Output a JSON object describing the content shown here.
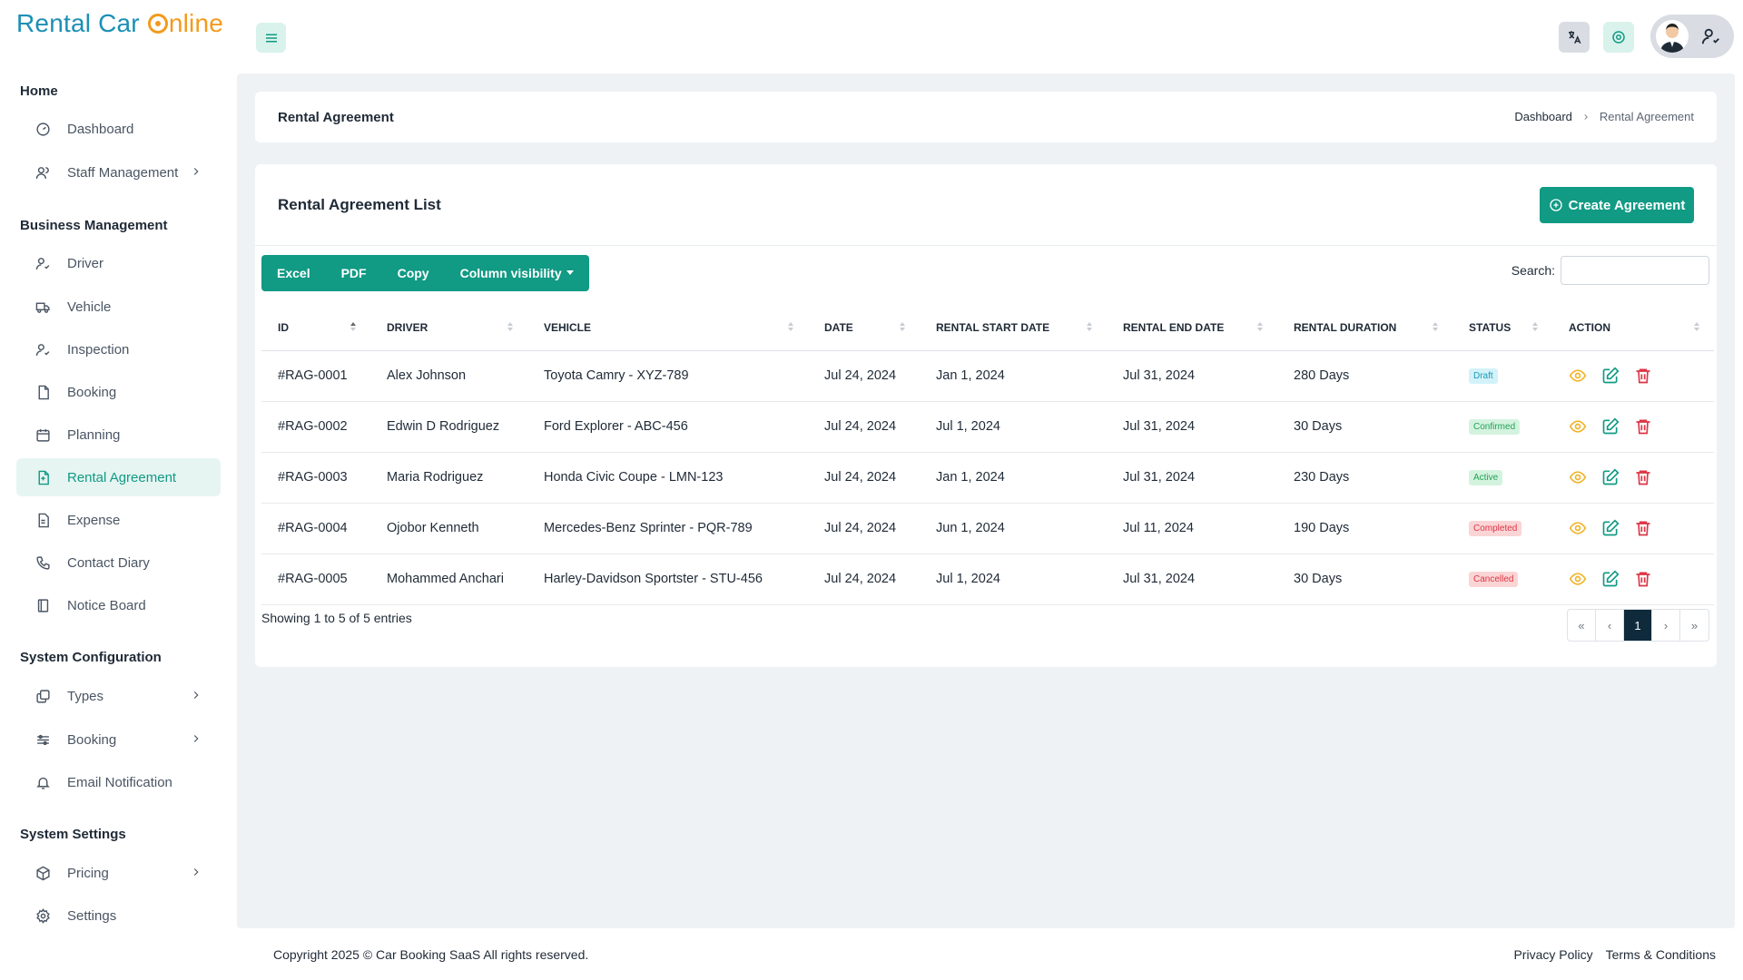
{
  "brand": {
    "part1": "Rental Car ",
    "part2": "nline"
  },
  "sidebar": {
    "sections": [
      {
        "title": "Home"
      },
      {
        "title": "Business Management"
      },
      {
        "title": "System Configuration"
      },
      {
        "title": "System Settings"
      }
    ],
    "items": [
      {
        "label": "Dashboard",
        "icon": "gauge-icon"
      },
      {
        "label": "Staff Management",
        "icon": "users-icon"
      },
      {
        "label": "Driver",
        "icon": "user-check-icon"
      },
      {
        "label": "Vehicle",
        "icon": "truck-icon"
      },
      {
        "label": "Inspection",
        "icon": "user-check-icon"
      },
      {
        "label": "Booking",
        "icon": "file-icon"
      },
      {
        "label": "Planning",
        "icon": "calendar-icon"
      },
      {
        "label": "Rental Agreement",
        "icon": "file-text-icon"
      },
      {
        "label": "Expense",
        "icon": "receipt-icon"
      },
      {
        "label": "Contact Diary",
        "icon": "phone-icon"
      },
      {
        "label": "Notice Board",
        "icon": "notebook-icon"
      },
      {
        "label": "Types",
        "icon": "layers-icon"
      },
      {
        "label": "Booking",
        "icon": "sliders-icon"
      },
      {
        "label": "Email Notification",
        "icon": "bell-icon"
      },
      {
        "label": "Pricing",
        "icon": "box-icon"
      },
      {
        "label": "Settings",
        "icon": "gear-icon"
      }
    ],
    "active": "Rental Agreement"
  },
  "page": {
    "title": "Rental Agreement",
    "breadcrumb": [
      "Dashboard",
      "Rental Agreement"
    ]
  },
  "list": {
    "title": "Rental Agreement List",
    "create_label": "Create Agreement",
    "export_buttons": [
      "Excel",
      "PDF",
      "Copy",
      "Column visibility"
    ],
    "search_label": "Search:",
    "search_value": "",
    "columns": [
      "ID",
      "DRIVER",
      "VEHICLE",
      "DATE",
      "RENTAL START DATE",
      "RENTAL END DATE",
      "RENTAL DURATION",
      "STATUS",
      "ACTION"
    ],
    "rows": [
      {
        "id": "#RAG-0001",
        "driver": "Alex Johnson",
        "vehicle": "Toyota Camry - XYZ-789",
        "date": "Jul 24, 2024",
        "start": "Jan 1, 2024",
        "end": "Jul 31, 2024",
        "duration": "280 Days",
        "status": "Draft"
      },
      {
        "id": "#RAG-0002",
        "driver": "Edwin D Rodriguez",
        "vehicle": "Ford Explorer - ABC-456",
        "date": "Jul 24, 2024",
        "start": "Jul 1, 2024",
        "end": "Jul 31, 2024",
        "duration": "30 Days",
        "status": "Confirmed"
      },
      {
        "id": "#RAG-0003",
        "driver": "Maria Rodriguez",
        "vehicle": "Honda Civic Coupe - LMN-123",
        "date": "Jul 24, 2024",
        "start": "Jan 1, 2024",
        "end": "Jul 31, 2024",
        "duration": "230 Days",
        "status": "Active"
      },
      {
        "id": "#RAG-0004",
        "driver": "Ojobor Kenneth",
        "vehicle": "Mercedes-Benz Sprinter - PQR-789",
        "date": "Jul 24, 2024",
        "start": "Jun 1, 2024",
        "end": "Jul 11, 2024",
        "duration": "190 Days",
        "status": "Completed"
      },
      {
        "id": "#RAG-0005",
        "driver": "Mohammed Anchari",
        "vehicle": "Harley-Davidson Sportster - STU-456",
        "date": "Jul 24, 2024",
        "start": "Jul 1, 2024",
        "end": "Jul 31, 2024",
        "duration": "30 Days",
        "status": "Cancelled"
      }
    ],
    "showing": "Showing 1 to 5 of 5 entries",
    "pager": [
      "«",
      "‹",
      "1",
      "›",
      "»"
    ],
    "current_page": "1"
  },
  "footer": {
    "copyright": "Copyright 2025 © Car Booking SaaS All rights reserved.",
    "links": [
      "Privacy Policy",
      "Terms & Conditions"
    ]
  },
  "colors": {
    "accent": "#119a84",
    "brand_blue": "#1b8fb5",
    "brand_orange": "#f39a1c",
    "pager_active": "#0e2a3b"
  }
}
